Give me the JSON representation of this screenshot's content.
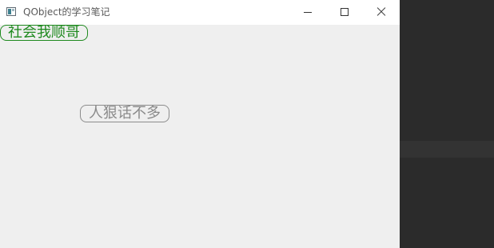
{
  "window": {
    "title": "QObject的学习笔记",
    "icon": "app-window-icon",
    "controls": {
      "minimize": "minimize-icon",
      "maximize": "maximize-icon",
      "close": "close-icon"
    }
  },
  "labels": {
    "green_label": "社会我顺哥",
    "gray_label": "人狠话不多"
  },
  "colors": {
    "green_label": "#1f8a1f",
    "gray_label": "#8a8a8a",
    "client_background": "#efefef",
    "desktop_background": "#2b2b2b"
  }
}
